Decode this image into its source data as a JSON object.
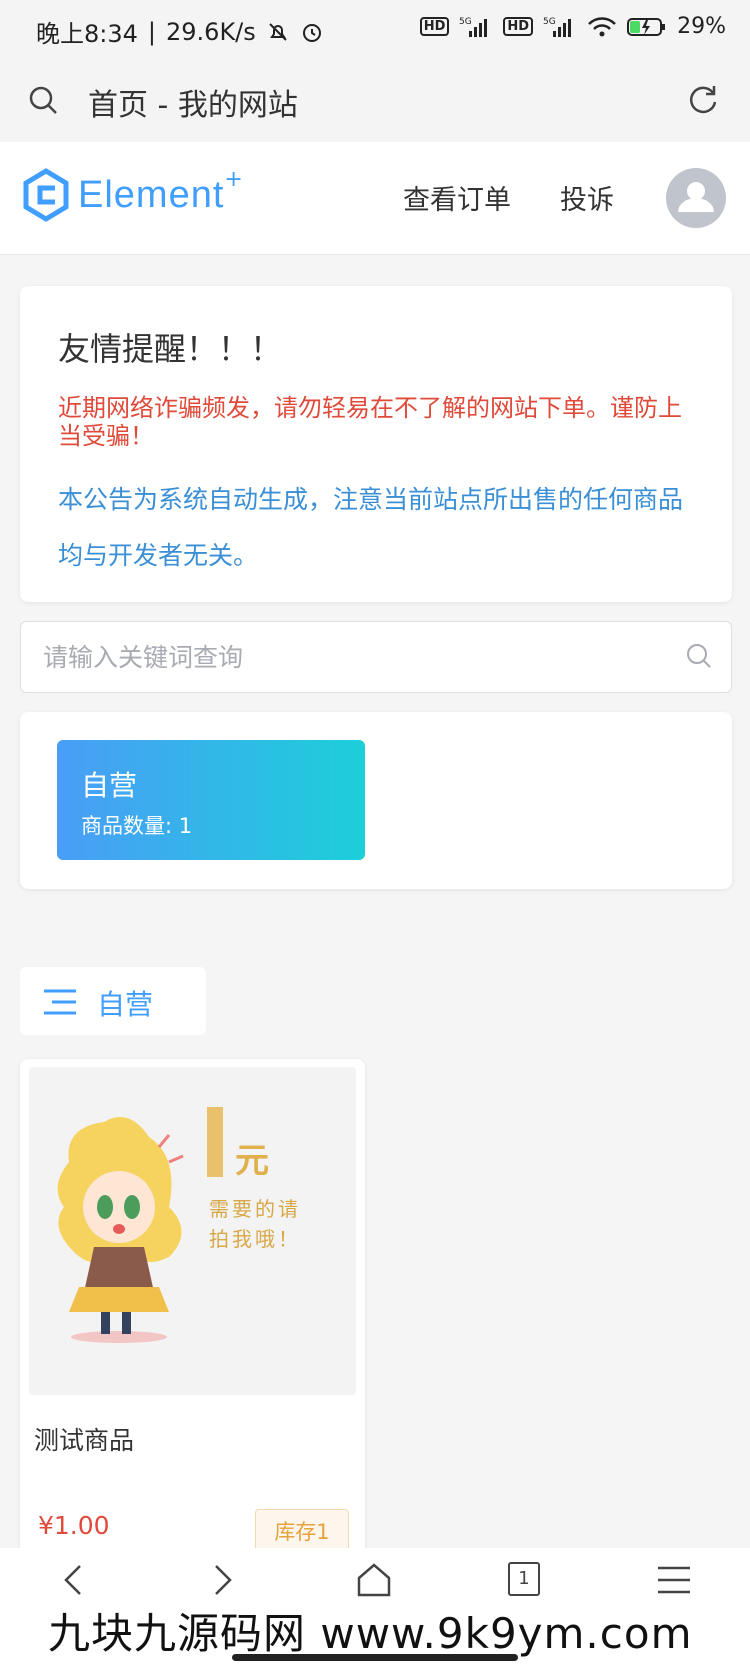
{
  "status_bar": {
    "time": "晚上8:34",
    "speed": "29.6K/s",
    "battery": "29%",
    "icons": [
      "mute-bell-icon",
      "alarm-icon",
      "hd-icon",
      "5g-signal-icon",
      "hd-icon",
      "5g-signal-icon",
      "wifi-icon",
      "battery-icon"
    ]
  },
  "browser": {
    "title": "首页 - 我的网站"
  },
  "header": {
    "logo_text": "Element",
    "logo_plus": "+",
    "nav": [
      "查看订单",
      "投诉"
    ]
  },
  "notice": {
    "title": "友情提醒！！！",
    "warning": "近期网络诈骗频发，请勿轻易在不了解的网站下单。谨防上当受骗！",
    "disclaimer": "本公告为系统自动生成，注意当前站点所出售的任何商品均与开发者无关。"
  },
  "search": {
    "placeholder": "请输入关键词查询"
  },
  "categories": [
    {
      "name": "自营",
      "count_label": "商品数量: 1"
    }
  ],
  "section": {
    "title": "自营"
  },
  "products": [
    {
      "name": "测试商品",
      "price": "¥1.00",
      "stock": "库存1",
      "image_text": {
        "big": "1",
        "unit": "元",
        "line1": "需要的请",
        "line2": "拍我哦！"
      }
    }
  ],
  "footer": {
    "tab_count": "1",
    "watermark": "九块九源码网 www.9k9ym.com"
  },
  "colors": {
    "accent": "#409eff",
    "warning_red": "#e04a3a",
    "disclaimer_blue": "#3a8fd6",
    "stock_orange": "#e6a23c"
  }
}
